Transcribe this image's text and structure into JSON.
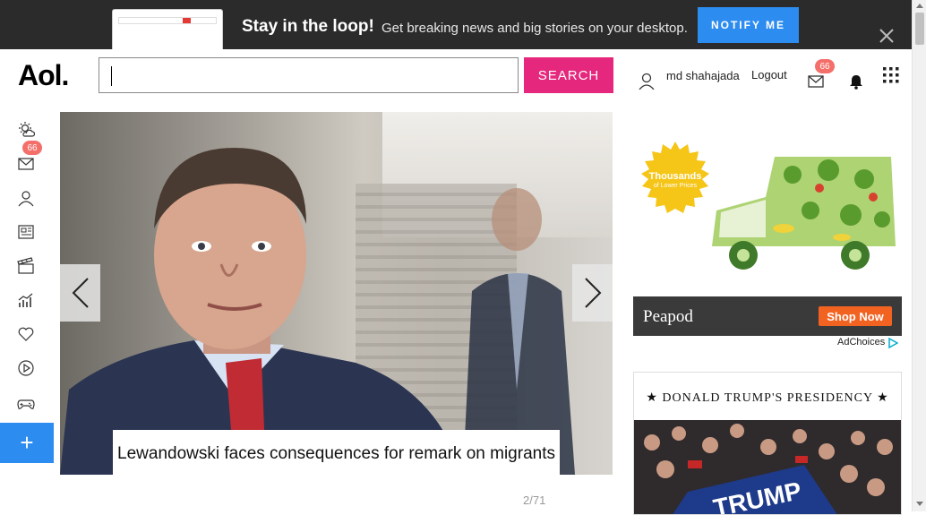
{
  "banner": {
    "title": "Stay in the loop!",
    "subtitle": "Get breaking news and big stories on your desktop.",
    "notify_label": "NOTIFY ME"
  },
  "header": {
    "logo": "Aol.",
    "search_value": "",
    "search_button": "SEARCH",
    "username": "md shahajada",
    "logout": "Logout",
    "mail_count": "66"
  },
  "sidebar": {
    "mail_count": "66",
    "items": [
      {
        "name": "weather-icon"
      },
      {
        "name": "mail-icon"
      },
      {
        "name": "profile-icon"
      },
      {
        "name": "news-icon"
      },
      {
        "name": "entertainment-icon"
      },
      {
        "name": "finance-icon"
      },
      {
        "name": "lifestyle-icon"
      },
      {
        "name": "video-icon"
      },
      {
        "name": "games-icon"
      }
    ],
    "add_label": "+"
  },
  "hero": {
    "caption": "Lewandowski faces consequences for remark on migrants",
    "counter": "2/71"
  },
  "ad": {
    "seal_line1": "Thousands",
    "seal_line2": "of Lower Prices",
    "brand": "Peapod",
    "cta": "Shop Now",
    "adchoices": "AdChoices"
  },
  "trump": {
    "title": "★ DONALD TRUMP'S PRESIDENCY ★",
    "sign_text": "TRUMP"
  },
  "colors": {
    "accent_pink": "#e5287d",
    "accent_blue": "#2d8cf0",
    "badge": "#f46f6a",
    "ad_orange": "#f26322"
  }
}
